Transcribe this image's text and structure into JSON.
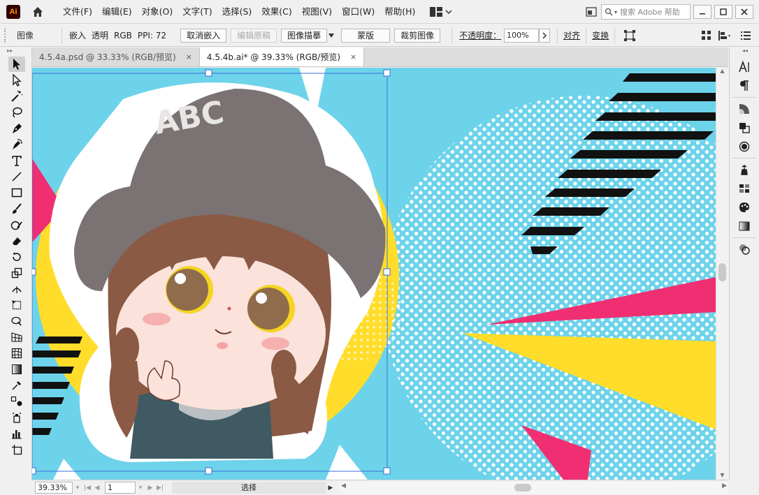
{
  "app": {
    "logo_text": "Ai",
    "menus": [
      "文件(F)",
      "编辑(E)",
      "对象(O)",
      "文字(T)",
      "选择(S)",
      "效果(C)",
      "视图(V)",
      "窗口(W)",
      "帮助(H)"
    ],
    "search_placeholder": "搜索 Adobe 帮助"
  },
  "control": {
    "selection_type": "图像",
    "embed": "嵌入",
    "transparency": "透明",
    "color_mode": "RGB",
    "ppi": "PPI: 72",
    "btn_unembed": "取消嵌入",
    "btn_edit_original": "编辑原稿",
    "btn_image_trace": "图像描摹",
    "btn_mask": "蒙版",
    "btn_crop": "裁剪图像",
    "opacity_label": "不透明度：",
    "opacity_value": "100%",
    "align": "对齐",
    "transform": "变换"
  },
  "tabs": [
    {
      "label": "4.5.4a.psd @ 33.33% (RGB/预览)",
      "close": "×"
    },
    {
      "label": "4.5.4b.ai* @ 39.33% (RGB/预览)",
      "close": "×"
    }
  ],
  "artboard": {
    "hat_text": "ABC"
  },
  "status": {
    "zoom": "39.33%",
    "page": "1",
    "tool_state": "选择"
  },
  "colors": {
    "cyan": "#6dd3ea",
    "yellow": "#ffdd2a",
    "pink": "#ef2f72",
    "hat": "#7a7273",
    "hair": "#8a5a44",
    "selection": "#3b6fd8"
  }
}
